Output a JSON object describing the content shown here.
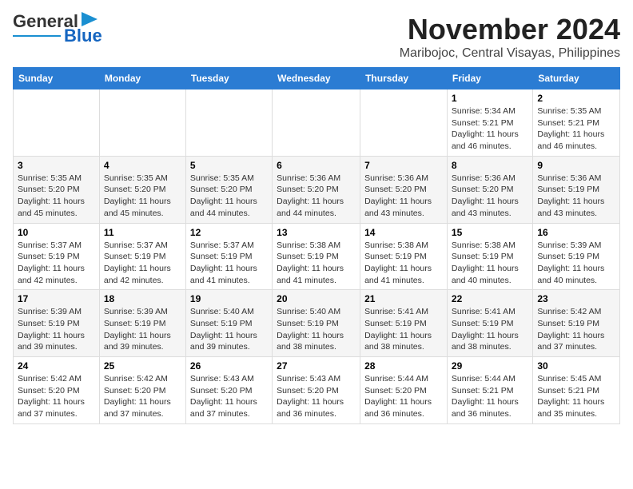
{
  "header": {
    "logo_line1": "General",
    "logo_line2": "Blue",
    "title": "November 2024",
    "subtitle": "Maribojoc, Central Visayas, Philippines"
  },
  "calendar": {
    "days_of_week": [
      "Sunday",
      "Monday",
      "Tuesday",
      "Wednesday",
      "Thursday",
      "Friday",
      "Saturday"
    ],
    "weeks": [
      [
        {
          "day": "",
          "info": ""
        },
        {
          "day": "",
          "info": ""
        },
        {
          "day": "",
          "info": ""
        },
        {
          "day": "",
          "info": ""
        },
        {
          "day": "",
          "info": ""
        },
        {
          "day": "1",
          "info": "Sunrise: 5:34 AM\nSunset: 5:21 PM\nDaylight: 11 hours\nand 46 minutes."
        },
        {
          "day": "2",
          "info": "Sunrise: 5:35 AM\nSunset: 5:21 PM\nDaylight: 11 hours\nand 46 minutes."
        }
      ],
      [
        {
          "day": "3",
          "info": "Sunrise: 5:35 AM\nSunset: 5:20 PM\nDaylight: 11 hours\nand 45 minutes."
        },
        {
          "day": "4",
          "info": "Sunrise: 5:35 AM\nSunset: 5:20 PM\nDaylight: 11 hours\nand 45 minutes."
        },
        {
          "day": "5",
          "info": "Sunrise: 5:35 AM\nSunset: 5:20 PM\nDaylight: 11 hours\nand 44 minutes."
        },
        {
          "day": "6",
          "info": "Sunrise: 5:36 AM\nSunset: 5:20 PM\nDaylight: 11 hours\nand 44 minutes."
        },
        {
          "day": "7",
          "info": "Sunrise: 5:36 AM\nSunset: 5:20 PM\nDaylight: 11 hours\nand 43 minutes."
        },
        {
          "day": "8",
          "info": "Sunrise: 5:36 AM\nSunset: 5:20 PM\nDaylight: 11 hours\nand 43 minutes."
        },
        {
          "day": "9",
          "info": "Sunrise: 5:36 AM\nSunset: 5:19 PM\nDaylight: 11 hours\nand 43 minutes."
        }
      ],
      [
        {
          "day": "10",
          "info": "Sunrise: 5:37 AM\nSunset: 5:19 PM\nDaylight: 11 hours\nand 42 minutes."
        },
        {
          "day": "11",
          "info": "Sunrise: 5:37 AM\nSunset: 5:19 PM\nDaylight: 11 hours\nand 42 minutes."
        },
        {
          "day": "12",
          "info": "Sunrise: 5:37 AM\nSunset: 5:19 PM\nDaylight: 11 hours\nand 41 minutes."
        },
        {
          "day": "13",
          "info": "Sunrise: 5:38 AM\nSunset: 5:19 PM\nDaylight: 11 hours\nand 41 minutes."
        },
        {
          "day": "14",
          "info": "Sunrise: 5:38 AM\nSunset: 5:19 PM\nDaylight: 11 hours\nand 41 minutes."
        },
        {
          "day": "15",
          "info": "Sunrise: 5:38 AM\nSunset: 5:19 PM\nDaylight: 11 hours\nand 40 minutes."
        },
        {
          "day": "16",
          "info": "Sunrise: 5:39 AM\nSunset: 5:19 PM\nDaylight: 11 hours\nand 40 minutes."
        }
      ],
      [
        {
          "day": "17",
          "info": "Sunrise: 5:39 AM\nSunset: 5:19 PM\nDaylight: 11 hours\nand 39 minutes."
        },
        {
          "day": "18",
          "info": "Sunrise: 5:39 AM\nSunset: 5:19 PM\nDaylight: 11 hours\nand 39 minutes."
        },
        {
          "day": "19",
          "info": "Sunrise: 5:40 AM\nSunset: 5:19 PM\nDaylight: 11 hours\nand 39 minutes."
        },
        {
          "day": "20",
          "info": "Sunrise: 5:40 AM\nSunset: 5:19 PM\nDaylight: 11 hours\nand 38 minutes."
        },
        {
          "day": "21",
          "info": "Sunrise: 5:41 AM\nSunset: 5:19 PM\nDaylight: 11 hours\nand 38 minutes."
        },
        {
          "day": "22",
          "info": "Sunrise: 5:41 AM\nSunset: 5:19 PM\nDaylight: 11 hours\nand 38 minutes."
        },
        {
          "day": "23",
          "info": "Sunrise: 5:42 AM\nSunset: 5:19 PM\nDaylight: 11 hours\nand 37 minutes."
        }
      ],
      [
        {
          "day": "24",
          "info": "Sunrise: 5:42 AM\nSunset: 5:20 PM\nDaylight: 11 hours\nand 37 minutes."
        },
        {
          "day": "25",
          "info": "Sunrise: 5:42 AM\nSunset: 5:20 PM\nDaylight: 11 hours\nand 37 minutes."
        },
        {
          "day": "26",
          "info": "Sunrise: 5:43 AM\nSunset: 5:20 PM\nDaylight: 11 hours\nand 37 minutes."
        },
        {
          "day": "27",
          "info": "Sunrise: 5:43 AM\nSunset: 5:20 PM\nDaylight: 11 hours\nand 36 minutes."
        },
        {
          "day": "28",
          "info": "Sunrise: 5:44 AM\nSunset: 5:20 PM\nDaylight: 11 hours\nand 36 minutes."
        },
        {
          "day": "29",
          "info": "Sunrise: 5:44 AM\nSunset: 5:21 PM\nDaylight: 11 hours\nand 36 minutes."
        },
        {
          "day": "30",
          "info": "Sunrise: 5:45 AM\nSunset: 5:21 PM\nDaylight: 11 hours\nand 35 minutes."
        }
      ]
    ]
  }
}
